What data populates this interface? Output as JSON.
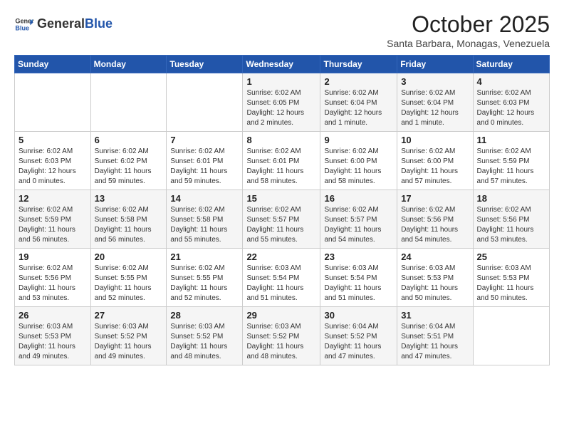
{
  "header": {
    "logo_general": "General",
    "logo_blue": "Blue",
    "month_title": "October 2025",
    "location": "Santa Barbara, Monagas, Venezuela"
  },
  "weekdays": [
    "Sunday",
    "Monday",
    "Tuesday",
    "Wednesday",
    "Thursday",
    "Friday",
    "Saturday"
  ],
  "weeks": [
    [
      {
        "day": "",
        "info": ""
      },
      {
        "day": "",
        "info": ""
      },
      {
        "day": "",
        "info": ""
      },
      {
        "day": "1",
        "info": "Sunrise: 6:02 AM\nSunset: 6:05 PM\nDaylight: 12 hours and 2 minutes."
      },
      {
        "day": "2",
        "info": "Sunrise: 6:02 AM\nSunset: 6:04 PM\nDaylight: 12 hours and 1 minute."
      },
      {
        "day": "3",
        "info": "Sunrise: 6:02 AM\nSunset: 6:04 PM\nDaylight: 12 hours and 1 minute."
      },
      {
        "day": "4",
        "info": "Sunrise: 6:02 AM\nSunset: 6:03 PM\nDaylight: 12 hours and 0 minutes."
      }
    ],
    [
      {
        "day": "5",
        "info": "Sunrise: 6:02 AM\nSunset: 6:03 PM\nDaylight: 12 hours and 0 minutes."
      },
      {
        "day": "6",
        "info": "Sunrise: 6:02 AM\nSunset: 6:02 PM\nDaylight: 11 hours and 59 minutes."
      },
      {
        "day": "7",
        "info": "Sunrise: 6:02 AM\nSunset: 6:01 PM\nDaylight: 11 hours and 59 minutes."
      },
      {
        "day": "8",
        "info": "Sunrise: 6:02 AM\nSunset: 6:01 PM\nDaylight: 11 hours and 58 minutes."
      },
      {
        "day": "9",
        "info": "Sunrise: 6:02 AM\nSunset: 6:00 PM\nDaylight: 11 hours and 58 minutes."
      },
      {
        "day": "10",
        "info": "Sunrise: 6:02 AM\nSunset: 6:00 PM\nDaylight: 11 hours and 57 minutes."
      },
      {
        "day": "11",
        "info": "Sunrise: 6:02 AM\nSunset: 5:59 PM\nDaylight: 11 hours and 57 minutes."
      }
    ],
    [
      {
        "day": "12",
        "info": "Sunrise: 6:02 AM\nSunset: 5:59 PM\nDaylight: 11 hours and 56 minutes."
      },
      {
        "day": "13",
        "info": "Sunrise: 6:02 AM\nSunset: 5:58 PM\nDaylight: 11 hours and 56 minutes."
      },
      {
        "day": "14",
        "info": "Sunrise: 6:02 AM\nSunset: 5:58 PM\nDaylight: 11 hours and 55 minutes."
      },
      {
        "day": "15",
        "info": "Sunrise: 6:02 AM\nSunset: 5:57 PM\nDaylight: 11 hours and 55 minutes."
      },
      {
        "day": "16",
        "info": "Sunrise: 6:02 AM\nSunset: 5:57 PM\nDaylight: 11 hours and 54 minutes."
      },
      {
        "day": "17",
        "info": "Sunrise: 6:02 AM\nSunset: 5:56 PM\nDaylight: 11 hours and 54 minutes."
      },
      {
        "day": "18",
        "info": "Sunrise: 6:02 AM\nSunset: 5:56 PM\nDaylight: 11 hours and 53 minutes."
      }
    ],
    [
      {
        "day": "19",
        "info": "Sunrise: 6:02 AM\nSunset: 5:56 PM\nDaylight: 11 hours and 53 minutes."
      },
      {
        "day": "20",
        "info": "Sunrise: 6:02 AM\nSunset: 5:55 PM\nDaylight: 11 hours and 52 minutes."
      },
      {
        "day": "21",
        "info": "Sunrise: 6:02 AM\nSunset: 5:55 PM\nDaylight: 11 hours and 52 minutes."
      },
      {
        "day": "22",
        "info": "Sunrise: 6:03 AM\nSunset: 5:54 PM\nDaylight: 11 hours and 51 minutes."
      },
      {
        "day": "23",
        "info": "Sunrise: 6:03 AM\nSunset: 5:54 PM\nDaylight: 11 hours and 51 minutes."
      },
      {
        "day": "24",
        "info": "Sunrise: 6:03 AM\nSunset: 5:53 PM\nDaylight: 11 hours and 50 minutes."
      },
      {
        "day": "25",
        "info": "Sunrise: 6:03 AM\nSunset: 5:53 PM\nDaylight: 11 hours and 50 minutes."
      }
    ],
    [
      {
        "day": "26",
        "info": "Sunrise: 6:03 AM\nSunset: 5:53 PM\nDaylight: 11 hours and 49 minutes."
      },
      {
        "day": "27",
        "info": "Sunrise: 6:03 AM\nSunset: 5:52 PM\nDaylight: 11 hours and 49 minutes."
      },
      {
        "day": "28",
        "info": "Sunrise: 6:03 AM\nSunset: 5:52 PM\nDaylight: 11 hours and 48 minutes."
      },
      {
        "day": "29",
        "info": "Sunrise: 6:03 AM\nSunset: 5:52 PM\nDaylight: 11 hours and 48 minutes."
      },
      {
        "day": "30",
        "info": "Sunrise: 6:04 AM\nSunset: 5:52 PM\nDaylight: 11 hours and 47 minutes."
      },
      {
        "day": "31",
        "info": "Sunrise: 6:04 AM\nSunset: 5:51 PM\nDaylight: 11 hours and 47 minutes."
      },
      {
        "day": "",
        "info": ""
      }
    ]
  ]
}
